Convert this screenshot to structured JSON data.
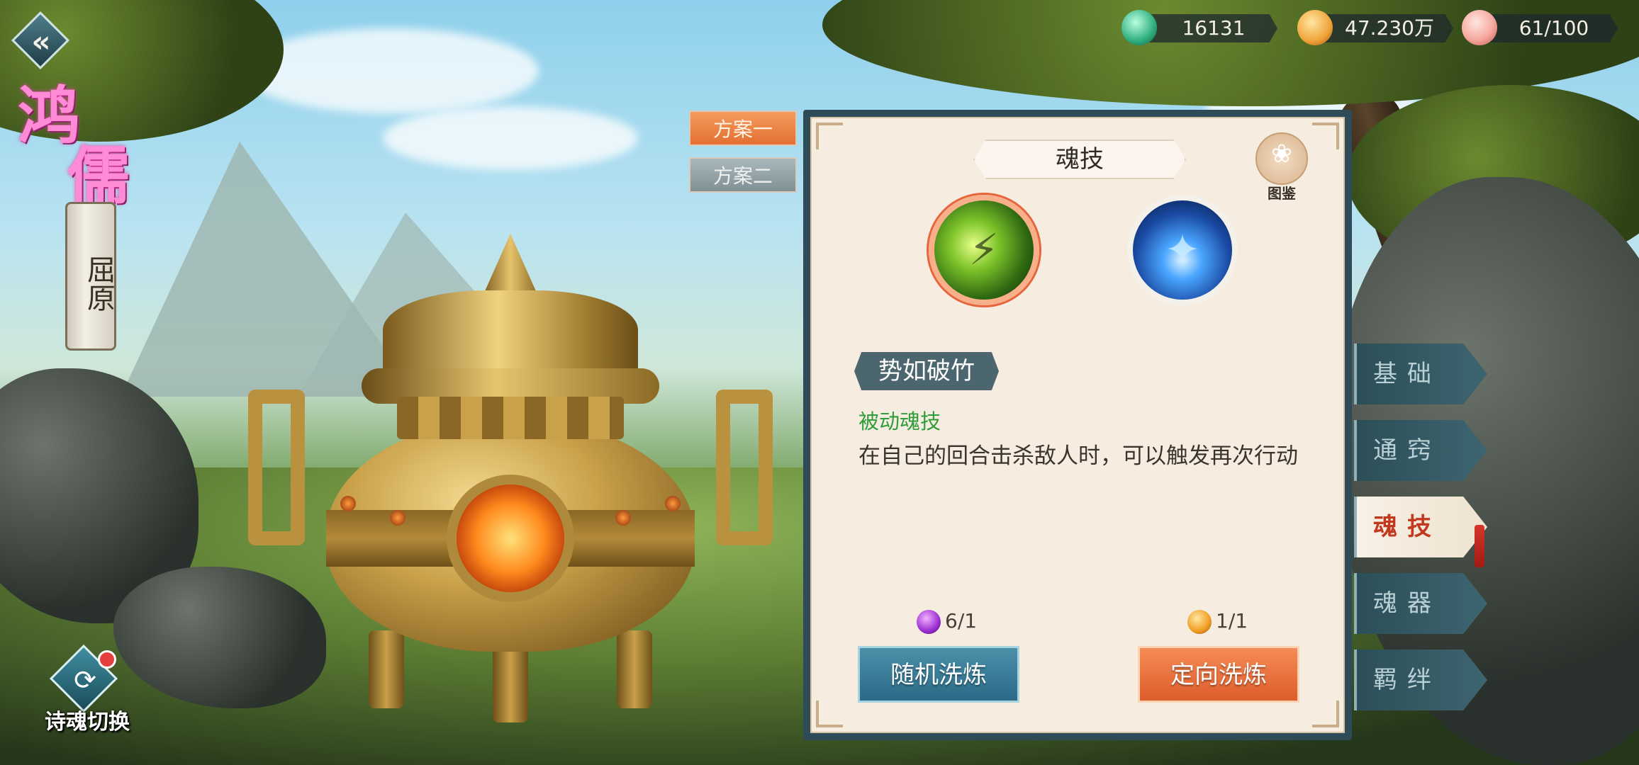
{
  "hero": {
    "title_char_1": "鸿",
    "title_char_2": "儒",
    "name": "屈原"
  },
  "currencies": [
    {
      "icon": "jade-icon",
      "value": "16131",
      "color": "#3bbf8f"
    },
    {
      "icon": "gold-ingot-icon",
      "value": "47.230万",
      "color": "#f0a43a"
    },
    {
      "icon": "peach-icon",
      "value": "61/100",
      "color": "#f6a9a0"
    }
  ],
  "plans": {
    "plan1": "方案一",
    "plan2": "方案二"
  },
  "panel": {
    "title": "魂技",
    "codex_label": "图鉴",
    "skill": {
      "name": "势如破竹",
      "type": "被动魂技",
      "description": "在自己的回合击杀敌人时，可以触发再次行动"
    },
    "costs": {
      "random": "6/1",
      "directed": "1/1"
    },
    "buttons": {
      "random": "随机洗炼",
      "directed": "定向洗炼"
    }
  },
  "side_tabs": [
    {
      "label": "基础",
      "active": false
    },
    {
      "label": "通窍",
      "active": false
    },
    {
      "label": "魂技",
      "active": true
    },
    {
      "label": "魂器",
      "active": false
    },
    {
      "label": "羁绊",
      "active": false
    }
  ],
  "switch_button": {
    "label": "诗魂切换",
    "has_notification": true
  }
}
